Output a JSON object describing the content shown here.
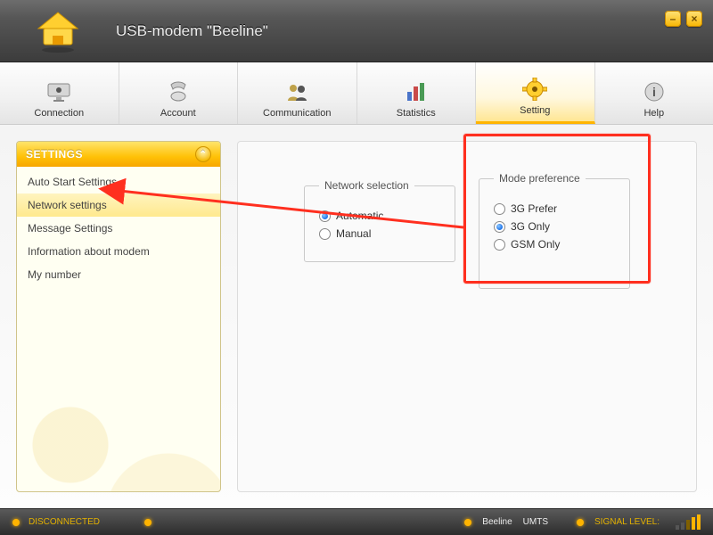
{
  "app": {
    "title": "USB-modem \"Beeline\""
  },
  "window_controls": {
    "minimize": "–",
    "close": "×"
  },
  "tabs": [
    {
      "id": "connection",
      "label": "Connection"
    },
    {
      "id": "account",
      "label": "Account"
    },
    {
      "id": "communication",
      "label": "Communication"
    },
    {
      "id": "statistics",
      "label": "Statistics"
    },
    {
      "id": "setting",
      "label": "Setting",
      "active": true
    },
    {
      "id": "help",
      "label": "Help"
    }
  ],
  "sidebar": {
    "title": "SETTINGS",
    "items": [
      {
        "label": "Auto Start Settings"
      },
      {
        "label": "Network settings",
        "selected": true
      },
      {
        "label": "Message Settings"
      },
      {
        "label": "Information about modem"
      },
      {
        "label": "My number"
      }
    ]
  },
  "settings_panel": {
    "network_selection": {
      "legend": "Network selection",
      "options": [
        {
          "label": "Automatic",
          "checked": true
        },
        {
          "label": "Manual",
          "checked": false
        }
      ]
    },
    "mode_preference": {
      "legend": "Mode preference",
      "options": [
        {
          "label": "3G Prefer",
          "checked": false
        },
        {
          "label": "3G Only",
          "checked": true
        },
        {
          "label": "GSM Only",
          "checked": false
        }
      ]
    }
  },
  "statusbar": {
    "connection_state": "DISCONNECTED",
    "operator": "Beeline",
    "network_type": "UMTS",
    "signal_label": "SIGNAL LEVEL:"
  },
  "annotation": {
    "highlight_target": "mode-preference-group",
    "arrow_from": "sidebar-item-network-settings",
    "arrow_to": "mode-preference-group"
  }
}
